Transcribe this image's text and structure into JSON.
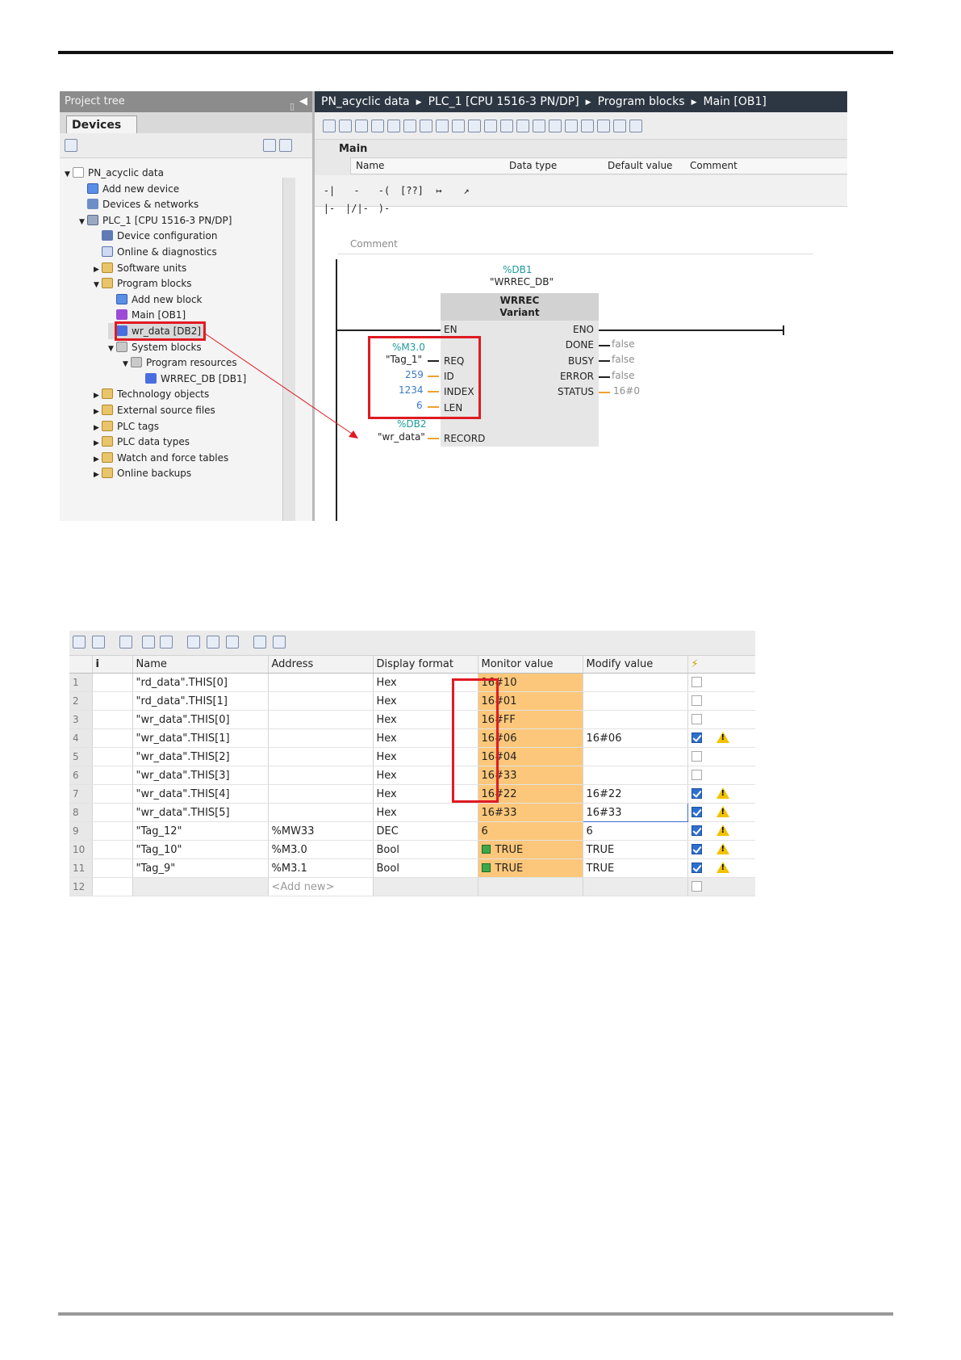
{
  "screenshot1": {
    "project_tree": {
      "title": "Project tree",
      "tab": "Devices",
      "items": [
        {
          "label": "PN_acyclic data",
          "level": 0,
          "expanded": true,
          "icon": "project-icon"
        },
        {
          "label": "Add new device",
          "level": 1,
          "icon": "add-device-icon"
        },
        {
          "label": "Devices & networks",
          "level": 1,
          "icon": "network-icon"
        },
        {
          "label": "PLC_1 [CPU 1516-3 PN/DP]",
          "level": 1,
          "expanded": true,
          "icon": "cpu-icon"
        },
        {
          "label": "Device configuration",
          "level": 2,
          "icon": "device-config-icon"
        },
        {
          "label": "Online & diagnostics",
          "level": 2,
          "icon": "diagnostics-icon"
        },
        {
          "label": "Software units",
          "level": 2,
          "collapsed": true,
          "icon": "folder-icon"
        },
        {
          "label": "Program blocks",
          "level": 2,
          "expanded": true,
          "icon": "folder-icon"
        },
        {
          "label": "Add new block",
          "level": 3,
          "icon": "add-block-icon"
        },
        {
          "label": "Main [OB1]",
          "level": 3,
          "icon": "ob-icon"
        },
        {
          "label": "wr_data [DB2]",
          "level": 3,
          "icon": "db-icon",
          "highlighted": true
        },
        {
          "label": "System blocks",
          "level": 3,
          "expanded": true,
          "icon": "system-folder-icon"
        },
        {
          "label": "Program resources",
          "level": 4,
          "expanded": true,
          "icon": "system-folder-icon"
        },
        {
          "label": "WRREC_DB [DB1]",
          "level": 5,
          "icon": "db-icon"
        },
        {
          "label": "Technology objects",
          "level": 2,
          "collapsed": true,
          "icon": "folder-icon"
        },
        {
          "label": "External source files",
          "level": 2,
          "collapsed": true,
          "icon": "folder-icon"
        },
        {
          "label": "PLC tags",
          "level": 2,
          "collapsed": true,
          "icon": "folder-icon"
        },
        {
          "label": "PLC data types",
          "level": 2,
          "collapsed": true,
          "icon": "folder-icon"
        },
        {
          "label": "Watch and force tables",
          "level": 2,
          "collapsed": true,
          "icon": "folder-icon"
        },
        {
          "label": "Online backups",
          "level": 2,
          "collapsed": true,
          "icon": "folder-icon"
        }
      ]
    },
    "breadcrumb": [
      "PN_acyclic data",
      "PLC_1 [CPU 1516-3 PN/DP]",
      "Program blocks",
      "Main [OB1]"
    ],
    "interface": {
      "title": "Main",
      "columns": [
        "Name",
        "Data type",
        "Default value",
        "Comment"
      ]
    },
    "ladder_tools": [
      "-| |-",
      "-|/|-",
      "-( )-",
      "[??]",
      "↦",
      "↗"
    ],
    "network": {
      "comment": "Comment",
      "instance_address": "%DB1",
      "instance_name": "\"WRREC_DB\"",
      "block_name": "WRREC",
      "block_type": "Variant",
      "inputs": [
        {
          "pin": "EN",
          "operand": ""
        },
        {
          "pin": "REQ",
          "operand": "\"Tag_1\"",
          "address": "%M3.0"
        },
        {
          "pin": "ID",
          "operand": "259"
        },
        {
          "pin": "INDEX",
          "operand": "1234"
        },
        {
          "pin": "LEN",
          "operand": "6"
        },
        {
          "pin": "RECORD",
          "operand": "\"wr_data\"",
          "address": "%DB2"
        }
      ],
      "outputs": [
        {
          "pin": "ENO",
          "value": ""
        },
        {
          "pin": "DONE",
          "value": "false"
        },
        {
          "pin": "BUSY",
          "value": "false"
        },
        {
          "pin": "ERROR",
          "value": "false"
        },
        {
          "pin": "STATUS",
          "value": "16#0"
        }
      ]
    }
  },
  "screenshot2": {
    "columns": [
      "i",
      "Name",
      "Address",
      "Display format",
      "Monitor value",
      "Modify value",
      "⚡"
    ],
    "rows": [
      {
        "n": "1",
        "name": "\"rd_data\".THIS[0]",
        "address": "",
        "format": "Hex",
        "monitor": "16#10",
        "modify": "",
        "checked": false,
        "warn": false
      },
      {
        "n": "2",
        "name": "\"rd_data\".THIS[1]",
        "address": "",
        "format": "Hex",
        "monitor": "16#01",
        "modify": "",
        "checked": false,
        "warn": false
      },
      {
        "n": "3",
        "name": "\"wr_data\".THIS[0]",
        "address": "",
        "format": "Hex",
        "monitor": "16#FF",
        "modify": "",
        "checked": false,
        "warn": false
      },
      {
        "n": "4",
        "name": "\"wr_data\".THIS[1]",
        "address": "",
        "format": "Hex",
        "monitor": "16#06",
        "modify": "16#06",
        "checked": true,
        "warn": true
      },
      {
        "n": "5",
        "name": "\"wr_data\".THIS[2]",
        "address": "",
        "format": "Hex",
        "monitor": "16#04",
        "modify": "",
        "checked": false,
        "warn": false
      },
      {
        "n": "6",
        "name": "\"wr_data\".THIS[3]",
        "address": "",
        "format": "Hex",
        "monitor": "16#33",
        "modify": "",
        "checked": false,
        "warn": false
      },
      {
        "n": "7",
        "name": "\"wr_data\".THIS[4]",
        "address": "",
        "format": "Hex",
        "monitor": "16#22",
        "modify": "16#22",
        "checked": true,
        "warn": true
      },
      {
        "n": "8",
        "name": "\"wr_data\".THIS[5]",
        "address": "",
        "format": "Hex",
        "monitor": "16#33",
        "modify": "16#33",
        "checked": true,
        "warn": true,
        "editing": true
      },
      {
        "n": "9",
        "name": "\"Tag_12\"",
        "address": "%MW33",
        "format": "DEC",
        "monitor": "6",
        "modify": "6",
        "checked": true,
        "warn": true
      },
      {
        "n": "10",
        "name": "\"Tag_10\"",
        "address": "%M3.0",
        "format": "Bool",
        "monitor": "TRUE",
        "modify": "TRUE",
        "checked": true,
        "warn": true,
        "bool": true
      },
      {
        "n": "11",
        "name": "\"Tag_9\"",
        "address": "%M3.1",
        "format": "Bool",
        "monitor": "TRUE",
        "modify": "TRUE",
        "checked": true,
        "warn": true,
        "bool": true
      },
      {
        "n": "12",
        "name": "",
        "address": "<Add new>",
        "format": "",
        "monitor": "",
        "modify": "",
        "checked": false,
        "warn": false,
        "placeholder": true
      }
    ]
  },
  "colors": {
    "highlight": "#e01b22",
    "monitor_bg": "#fcc77a",
    "breadcrumb_bg": "#2d3743",
    "operand_blue": "#3a79c8",
    "address_teal": "#1f9a9a"
  }
}
